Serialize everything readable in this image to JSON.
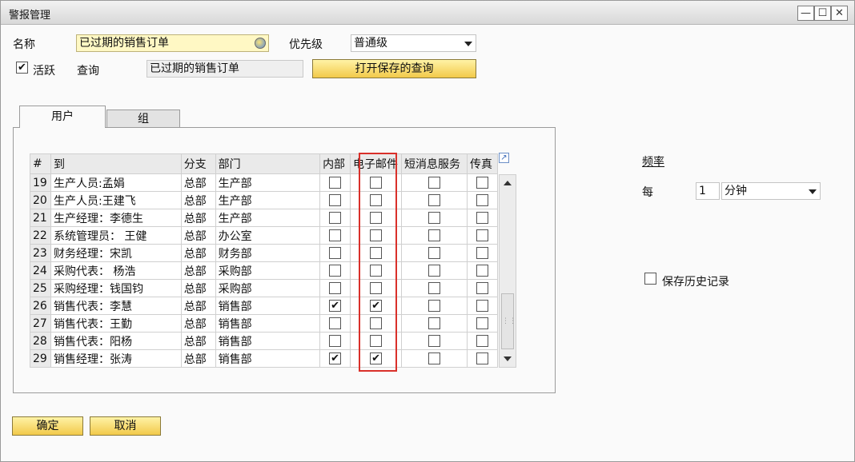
{
  "window": {
    "title": "警报管理",
    "controls": {
      "minimize": "—",
      "maximize": "☐",
      "close": "✕"
    }
  },
  "form": {
    "name_label": "名称",
    "name_value": "已过期的销售订单",
    "priority_label": "优先级",
    "priority_value": "普通级",
    "active_label": "活跃",
    "active_checked": true,
    "query_label": "查询",
    "query_value": "已过期的销售订单",
    "open_query_button": "打开保存的查询"
  },
  "tabs": [
    {
      "label": "用户",
      "active": true
    },
    {
      "label": "组",
      "active": false
    }
  ],
  "grid": {
    "headers": {
      "num": "#",
      "to": "到",
      "branch": "分支",
      "dept": "部门",
      "internal": "内部",
      "email": "电子邮件",
      "sms": "短消息服务",
      "fax": "传真"
    },
    "rows": [
      {
        "num": "19",
        "to": "生产人员:孟娟",
        "branch": "总部",
        "dept": "生产部",
        "internal": false,
        "email": false,
        "sms": false,
        "fax": false
      },
      {
        "num": "20",
        "to": "生产人员:王建飞",
        "branch": "总部",
        "dept": "生产部",
        "internal": false,
        "email": false,
        "sms": false,
        "fax": false
      },
      {
        "num": "21",
        "to": "生产经理：李德生",
        "branch": "总部",
        "dept": "生产部",
        "internal": false,
        "email": false,
        "sms": false,
        "fax": false
      },
      {
        "num": "22",
        "to": "系统管理员： 王健",
        "branch": "总部",
        "dept": "办公室",
        "internal": false,
        "email": false,
        "sms": false,
        "fax": false
      },
      {
        "num": "23",
        "to": "财务经理：宋凯",
        "branch": "总部",
        "dept": "财务部",
        "internal": false,
        "email": false,
        "sms": false,
        "fax": false
      },
      {
        "num": "24",
        "to": "采购代表： 杨浩",
        "branch": "总部",
        "dept": "采购部",
        "internal": false,
        "email": false,
        "sms": false,
        "fax": false
      },
      {
        "num": "25",
        "to": "采购经理：钱国钧",
        "branch": "总部",
        "dept": "采购部",
        "internal": false,
        "email": false,
        "sms": false,
        "fax": false
      },
      {
        "num": "26",
        "to": "销售代表：李慧",
        "branch": "总部",
        "dept": "销售部",
        "internal": true,
        "email": true,
        "sms": false,
        "fax": false
      },
      {
        "num": "27",
        "to": "销售代表：王勤",
        "branch": "总部",
        "dept": "销售部",
        "internal": false,
        "email": false,
        "sms": false,
        "fax": false
      },
      {
        "num": "28",
        "to": "销售代表：阳杨",
        "branch": "总部",
        "dept": "销售部",
        "internal": false,
        "email": false,
        "sms": false,
        "fax": false
      },
      {
        "num": "29",
        "to": "销售经理：张涛",
        "branch": "总部",
        "dept": "销售部",
        "internal": true,
        "email": true,
        "sms": false,
        "fax": false
      }
    ]
  },
  "frequency": {
    "label": "频率",
    "every_label": "每",
    "value": "1",
    "unit": "分钟"
  },
  "save_history": {
    "label": "保存历史记录",
    "checked": false
  },
  "buttons": {
    "ok": "确定",
    "cancel": "取消"
  },
  "icons": {
    "checkmark": "✔",
    "link_icon": "query-link-icon",
    "expand_icon": "expand-arrow-icon"
  }
}
